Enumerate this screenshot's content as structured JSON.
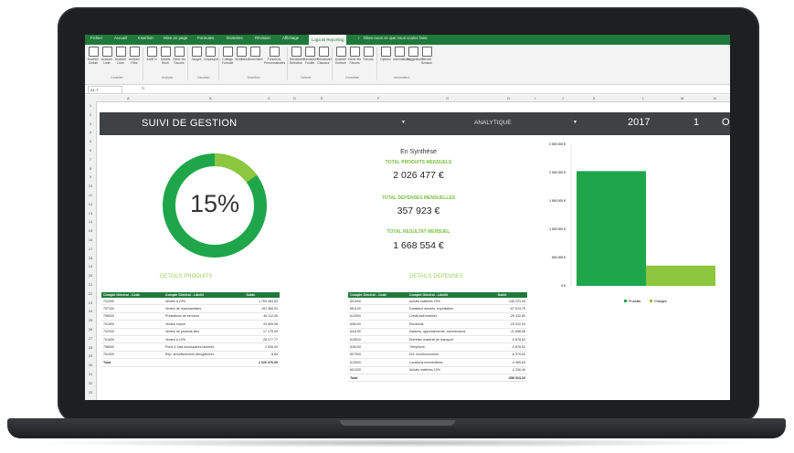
{
  "ribbon": {
    "tabs": [
      "Fichier",
      "Accueil",
      "Insertion",
      "Mise en page",
      "Formules",
      "Données",
      "Révision",
      "Affichage",
      "Loga BI Reporting"
    ],
    "search_hint": "Dites-nous ce que vous voulez faire",
    "buttons": [
      "Accéder Cellule",
      "Accéder Liste",
      "Accéder Cube",
      "Accéder Filtre",
      "Audit N",
      "Détails Rech",
      "Gérer les Favoris",
      "Jauges",
      "Graphiques",
      "Collage Formule",
      "Ventilation",
      "Sommaire",
      "Fonctions Personnalisées",
      "Recalculer Sélection",
      "Recalculer Feuille",
      "Recalculer Classeur",
      "Accéder Ecriture",
      "Gérer les Favoris",
      "Favoris",
      "Options",
      "Informations",
      "Suggestions",
      "Fermer Session"
    ],
    "groups": [
      "Consulter",
      "Analyser",
      "Visualiser",
      "Modéliser",
      "Calculer",
      "Consolider",
      "Informations"
    ]
  },
  "formula_bar": {
    "name_box": "A1:T",
    "fx": "fx"
  },
  "columns": [
    "A",
    "B",
    "C",
    "D",
    "E",
    "F",
    "G",
    "H",
    "I",
    "J",
    "K",
    "L",
    "M",
    "N"
  ],
  "rows": [
    "1",
    "2",
    "3",
    "4",
    "5",
    "6",
    "7",
    "8",
    "9",
    "10",
    "11",
    "12",
    "13",
    "14",
    "15",
    "16",
    "17",
    "18",
    "19",
    "20",
    "21",
    "22",
    "23",
    "24",
    "25",
    "26",
    "27",
    "28",
    "29",
    "30",
    "31",
    "32",
    "33"
  ],
  "dashboard": {
    "title": "SUIVI DE GESTION",
    "view": "ANALYTIQUE",
    "year": "2017",
    "month": "1",
    "last": "O",
    "gauge_percent": "15%",
    "gauge_value": 0.15
  },
  "synthesis": {
    "title": "En Synthèse",
    "produits_label": "TOTAL PRODUITS MENSUELS",
    "produits_value": "2 026 477 €",
    "depenses_label": "TOTAL DEPENSES MENSUELLES",
    "depenses_value": "357 923 €",
    "resultat_label": "TOTAL RESULTAT MENSUEL",
    "resultat_value": "1 668 554 €"
  },
  "produits_table": {
    "title": "DETAILS PRODUITS",
    "headers": [
      "Compte Général - Code",
      "Compte Général - Libellé",
      "Solde"
    ],
    "rows": [
      [
        "701000",
        "Ventes à 20%",
        "1 769 464,53"
      ],
      [
        "707100",
        "Ventes de marchandises",
        "151 360,03"
      ],
      [
        "706000",
        "Prestations de services",
        "46 112,06"
      ],
      [
        "701500",
        "Ventes export",
        "33 409,98"
      ],
      [
        "702000",
        "Ventes de produits finis",
        "17 175,00"
      ],
      [
        "701600",
        "Ventes à 10%",
        "28 177,77"
      ],
      [
        "708500",
        "Ports & frais accessoires facturés",
        "1 005,00"
      ],
      [
        "781500",
        "Rep. amortissement dérogatoires",
        "8,80"
      ]
    ],
    "total_label": "Total",
    "total_value": "2 026 476,99"
  },
  "depenses_table": {
    "title": "DETAILS DEPENSES",
    "headers": [
      "Compte Général - Code",
      "Compte Général - Libellé",
      "Solde"
    ],
    "rows": [
      [
        "601000",
        "Achats matières 20%",
        "-135 223,49"
      ],
      [
        "681100",
        "Dotations amortis. exploitation",
        "-67 613,75"
      ],
      [
        "612000",
        "Crédit-bail mobilier",
        "-25 332,80"
      ],
      [
        "606100",
        "Electricité",
        "-23 922,94"
      ],
      [
        "641100",
        "Salaires, appointements, commissions",
        "-11 658,96"
      ],
      [
        "615510",
        "Entretien matériel de transport",
        "-9 878,52"
      ],
      [
        "626100",
        "Téléphone",
        "-9 878,52"
      ],
      [
        "607000",
        "Ent. fonctionnement",
        "-6 579,52"
      ],
      [
        "613000",
        "Locations immobilières",
        "-4 985,63"
      ],
      [
        "601020",
        "Achats matières 10%",
        "-4 306,40"
      ]
    ],
    "total_label": "Total",
    "total_value": "-358 923,33"
  },
  "chart_data": {
    "type": "bar",
    "categories": [
      "Produits",
      "Charges"
    ],
    "series": [
      {
        "name": "Produits",
        "values": [
          2026477,
          0
        ]
      },
      {
        "name": "Charges",
        "values": [
          0,
          357923
        ]
      }
    ],
    "colors": [
      "#1fa64a",
      "#8dc63f"
    ],
    "ylim": [
      0,
      2500000
    ],
    "yticks": [
      "0 €",
      "500 000 €",
      "1 000 000 €",
      "1 500 000 €",
      "2 000 000 €",
      "2 500 000 €"
    ],
    "legend": [
      "Produits",
      "Charges"
    ],
    "legend_position": "bottom"
  }
}
